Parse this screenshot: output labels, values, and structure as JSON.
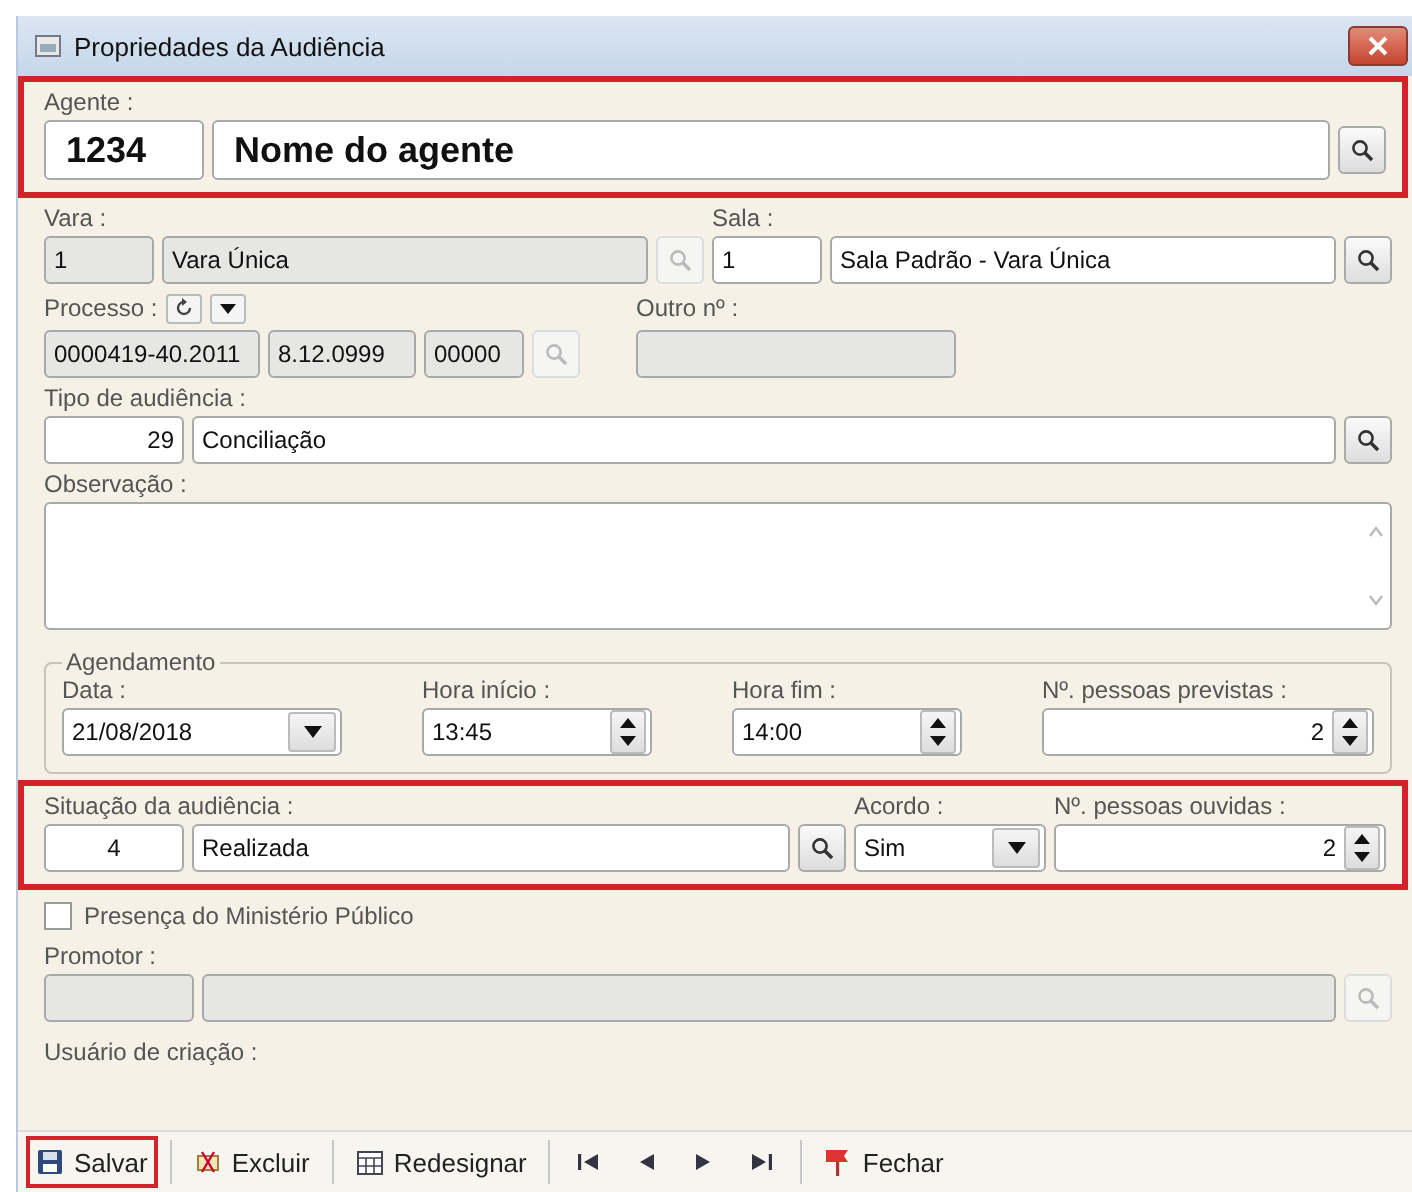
{
  "window": {
    "title": "Propriedades da Audiência"
  },
  "agent": {
    "highlighted": true,
    "label": "Agente :",
    "code": {
      "value": "1234",
      "disabled": false
    },
    "name": {
      "value": "Nome do agente",
      "disabled": false
    },
    "search": {
      "disabled": false
    }
  },
  "vara": {
    "label": "Vara :",
    "code": {
      "value": "1",
      "disabled": true
    },
    "name": {
      "value": "Vara Única",
      "disabled": true
    },
    "search": {
      "disabled": true
    }
  },
  "sala": {
    "label": "Sala :",
    "code": {
      "value": "1",
      "disabled": false
    },
    "name": {
      "value": "Sala Padrão - Vara Única",
      "disabled": false
    },
    "search": {
      "disabled": false
    }
  },
  "processo": {
    "label": "Processo :",
    "parts": [
      {
        "value": "0000419-40.2011",
        "disabled": true
      },
      {
        "value": "8.12.0999",
        "disabled": true
      },
      {
        "value": "00000",
        "disabled": true
      }
    ],
    "search": {
      "disabled": true
    }
  },
  "outro": {
    "label": "Outro nº :",
    "disabled": true
  },
  "tipo": {
    "label": "Tipo de audiência :",
    "code": {
      "value": "29",
      "disabled": false
    },
    "name": {
      "value": "Conciliação",
      "disabled": false
    },
    "search": {
      "disabled": false
    }
  },
  "observacao": {
    "label": "Observação :"
  },
  "agendamento": {
    "title": "Agendamento",
    "fields": [
      {
        "kind": "combo",
        "label": "Data :",
        "value": "21/08/2018"
      },
      {
        "kind": "spin",
        "label": "Hora início :",
        "value": "13:45"
      },
      {
        "kind": "spin",
        "label": "Hora fim :",
        "value": "14:00"
      },
      {
        "kind": "count",
        "label": "Nº. pessoas previstas :",
        "value": "2"
      }
    ]
  },
  "situacao": {
    "highlighted": true,
    "label": "Situação da audiência :",
    "code": {
      "value": "4",
      "disabled": false
    },
    "name": {
      "value": "Realizada",
      "disabled": false
    },
    "search": {
      "disabled": false
    },
    "acordo": {
      "label": "Acordo :",
      "value": "Sim"
    },
    "ouvidas": {
      "label": "Nº. pessoas ouvidas :",
      "value": "2"
    }
  },
  "presenca": {
    "label": "Presença do Ministério Público",
    "checked": false
  },
  "promotor": {
    "label": "Promotor :",
    "code": {
      "disabled": true
    },
    "name": {
      "disabled": true
    },
    "search": {
      "disabled": true
    }
  },
  "usuario": {
    "label": "Usuário de criação :"
  },
  "toolbar": [
    {
      "kind": "save",
      "label": "Salvar",
      "highlighted": true
    },
    {
      "kind": "delete",
      "label": "Excluir",
      "highlighted": false
    },
    {
      "kind": "reschedule",
      "label": "Redesignar",
      "highlighted": false
    },
    {
      "kind": "first"
    },
    {
      "kind": "prev"
    },
    {
      "kind": "next"
    },
    {
      "kind": "last"
    },
    {
      "kind": "close",
      "label": "Fechar",
      "highlighted": false
    }
  ]
}
